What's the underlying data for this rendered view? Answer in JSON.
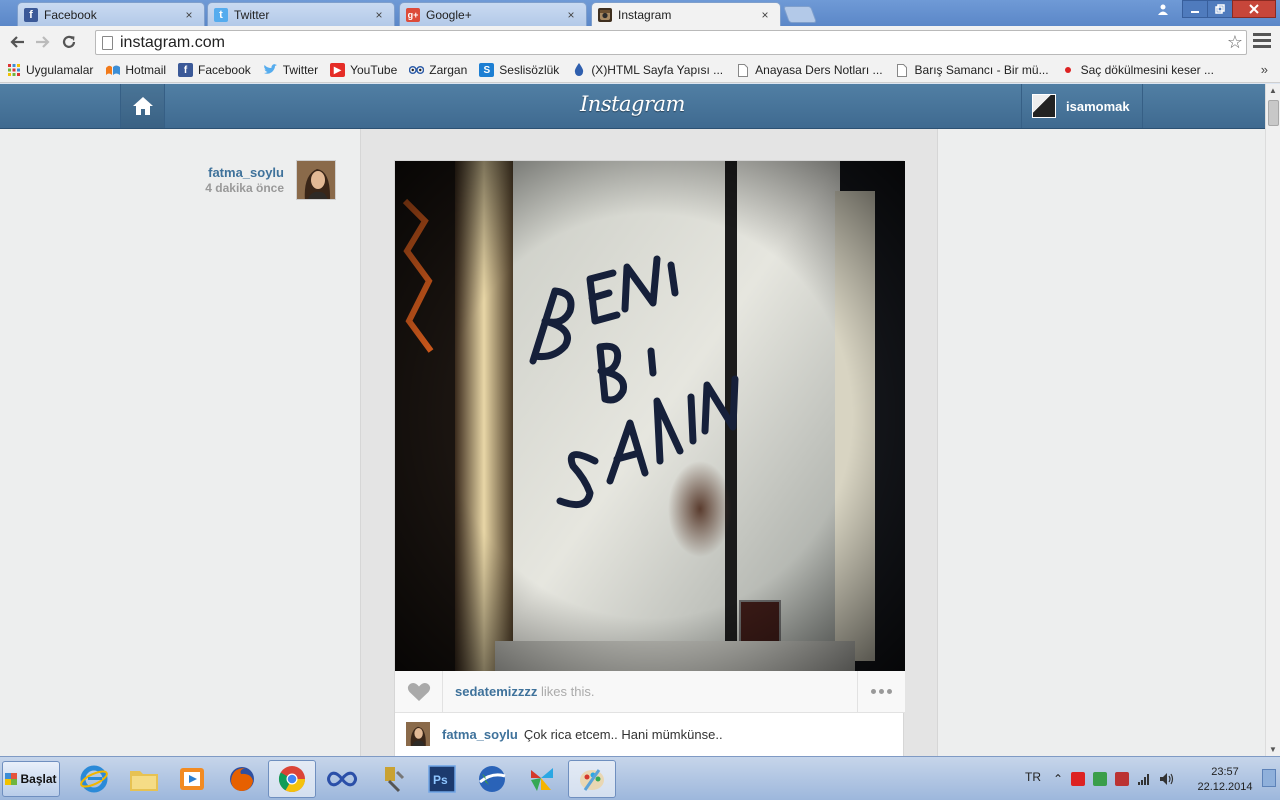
{
  "browser": {
    "tabs": [
      {
        "title": "Facebook",
        "favicon": "facebook-icon",
        "color": "#3b5998",
        "glyph": "f",
        "active": false
      },
      {
        "title": "Twitter",
        "favicon": "twitter-icon",
        "color": "#55acee",
        "glyph": "t",
        "active": false
      },
      {
        "title": "Google+",
        "favicon": "google-plus-icon",
        "color": "#dd4b39",
        "glyph": "g+",
        "active": false
      },
      {
        "title": "Instagram",
        "favicon": "instagram-icon",
        "color": "#3f2f1f",
        "glyph": "◙",
        "active": true
      }
    ],
    "tab_close_glyph": "×",
    "address": "instagram.com",
    "bookmarks": [
      {
        "label": "Uygulamalar",
        "icon": "apps-grid-icon",
        "color": "#d33"
      },
      {
        "label": "Hotmail",
        "icon": "hotmail-icon",
        "color": "#f27a1a"
      },
      {
        "label": "Facebook",
        "icon": "facebook-icon",
        "color": "#3b5998"
      },
      {
        "label": "Twitter",
        "icon": "twitter-icon",
        "color": "#55acee"
      },
      {
        "label": "YouTube",
        "icon": "youtube-icon",
        "color": "#e52d27"
      },
      {
        "label": "Zargan",
        "icon": "zargan-icon",
        "color": "#2a5aa8"
      },
      {
        "label": "Seslisözlük",
        "icon": "seslisozluk-icon",
        "color": "#1d7fd3"
      },
      {
        "label": "(X)HTML Sayfa Yapısı ...",
        "icon": "droplet-icon",
        "color": "#2f5fae"
      },
      {
        "label": "Anayasa Ders Notları ...",
        "icon": "page-icon",
        "color": "#ffffff"
      },
      {
        "label": "Barış Samancı - Bir mü...",
        "icon": "page-icon",
        "color": "#ffffff"
      },
      {
        "label": "Saç dökülmesini keser ...",
        "icon": "dot-icon",
        "color": "#d22"
      }
    ],
    "bookmarks_more": "»"
  },
  "instagram": {
    "logo": "Instagram",
    "current_user": "isamomak",
    "post": {
      "author": "fatma_soylu",
      "time_ago": "4 dakika önce",
      "liker": "sedatemizzzz",
      "likes_suffix": " likes this.",
      "comment_user": "fatma_soylu",
      "comment_text": "Çok rica etcem.. Hani mümkünse.."
    },
    "brand_color": "#3f729b"
  },
  "taskbar": {
    "start_label": "Başlat",
    "apps": [
      {
        "name": "internet-explorer-icon",
        "color": "#2b8ad8"
      },
      {
        "name": "file-explorer-icon",
        "color": "#e7c252"
      },
      {
        "name": "media-player-icon",
        "color": "#f28b22"
      },
      {
        "name": "firefox-icon",
        "color": "#e66000"
      },
      {
        "name": "chrome-icon",
        "color": "#3a9e4a"
      },
      {
        "name": "infinity-app-icon",
        "color": "#2b4fa8"
      },
      {
        "name": "tools-app-icon",
        "color": "#c9a233"
      },
      {
        "name": "photoshop-icon",
        "color": "#1c3a6e"
      },
      {
        "name": "google-earth-icon",
        "color": "#2a63b8"
      },
      {
        "name": "colorful-app-icon",
        "color": "#d5382c"
      },
      {
        "name": "paint-icon",
        "color": "#5ba3d9"
      }
    ],
    "language": "TR",
    "clock_time": "23:57",
    "clock_date": "22.12.2014"
  }
}
